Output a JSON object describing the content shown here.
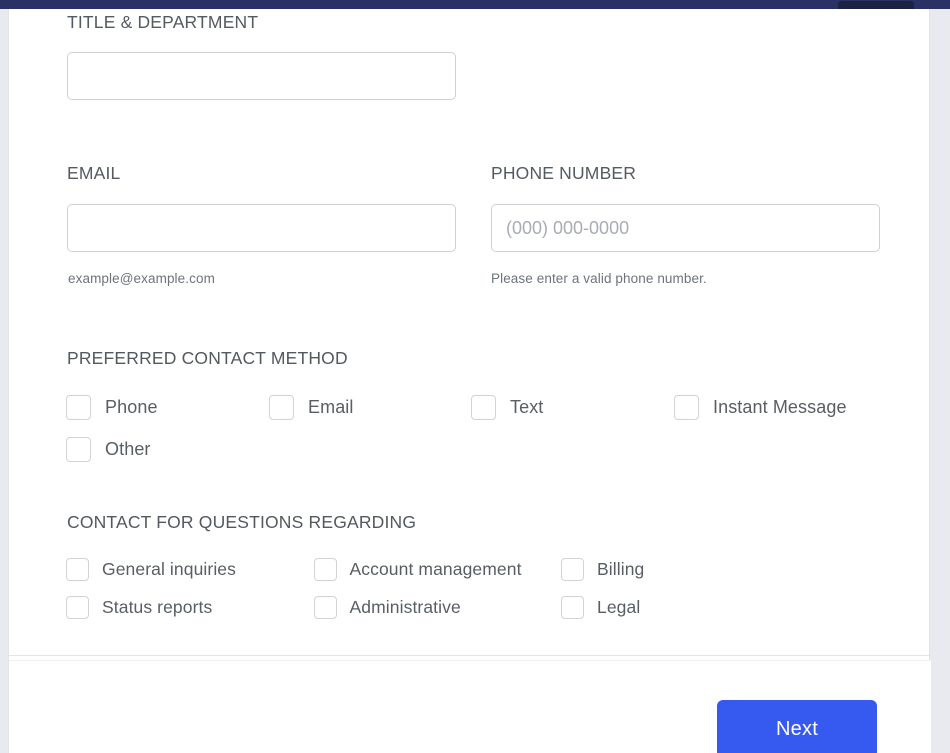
{
  "top_bar": {
    "chip_name": "browser-tab-chip",
    "color": "#2a3164",
    "chip_color": "#1c2340"
  },
  "form": {
    "title_department": {
      "label": "TITLE & DEPARTMENT",
      "value": "",
      "placeholder": ""
    },
    "email": {
      "label": "EMAIL",
      "value": "",
      "placeholder": "",
      "hint": "example@example.com"
    },
    "phone": {
      "label": "PHONE NUMBER",
      "value": "",
      "placeholder": "(000) 000-0000",
      "hint": "Please enter a valid phone number."
    },
    "preferred_contact_method": {
      "label": "PREFERRED CONTACT METHOD",
      "options": [
        {
          "label": "Phone",
          "checked": false
        },
        {
          "label": "Email",
          "checked": false
        },
        {
          "label": "Text",
          "checked": false
        },
        {
          "label": "Instant Message",
          "checked": false
        },
        {
          "label": "Other",
          "checked": false
        }
      ]
    },
    "contact_for_questions_regarding": {
      "label": "CONTACT FOR QUESTIONS REGARDING",
      "options": [
        {
          "label": "General inquiries",
          "checked": false
        },
        {
          "label": "Account management",
          "checked": false
        },
        {
          "label": "Billing",
          "checked": false
        },
        {
          "label": "Status reports",
          "checked": false
        },
        {
          "label": "Administrative",
          "checked": false
        },
        {
          "label": "Legal",
          "checked": false
        }
      ]
    }
  },
  "footer": {
    "next_label": "Next",
    "next_color": "#3659f0"
  }
}
